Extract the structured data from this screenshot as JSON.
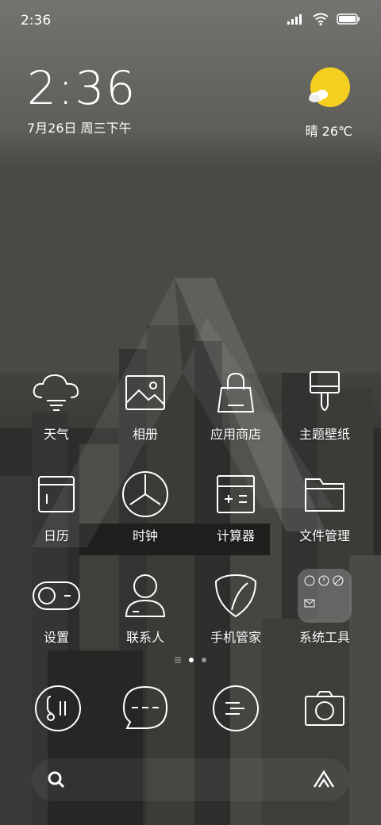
{
  "status_bar": {
    "time": "2:36"
  },
  "clock_widget": {
    "time": "2:36",
    "date": "7月26日 周三下午"
  },
  "weather_widget": {
    "summary": "晴 26℃",
    "icon": "sun-cloud-icon"
  },
  "apps": [
    {
      "label": "天气",
      "icon": "cloud-icon"
    },
    {
      "label": "相册",
      "icon": "gallery-icon"
    },
    {
      "label": "应用商店",
      "icon": "shopping-bag-icon"
    },
    {
      "label": "主题壁纸",
      "icon": "paint-brush-icon"
    },
    {
      "label": "日历",
      "icon": "calendar-icon"
    },
    {
      "label": "时钟",
      "icon": "clock-icon"
    },
    {
      "label": "计算器",
      "icon": "calculator-icon"
    },
    {
      "label": "文件管理",
      "icon": "folder-icon"
    },
    {
      "label": "设置",
      "icon": "toggle-icon"
    },
    {
      "label": "联系人",
      "icon": "person-icon"
    },
    {
      "label": "手机管家",
      "icon": "shield-icon"
    },
    {
      "label": "系统工具",
      "icon": "folder-group-icon"
    }
  ],
  "page_indicator": {
    "pages": 2,
    "current": 1
  },
  "dock": [
    {
      "icon": "phone-icon"
    },
    {
      "icon": "message-icon"
    },
    {
      "icon": "browser-icon"
    },
    {
      "icon": "camera-icon"
    }
  ],
  "search_bar": {
    "left_icon": "search-icon",
    "right_icon": "assistant-icon"
  }
}
